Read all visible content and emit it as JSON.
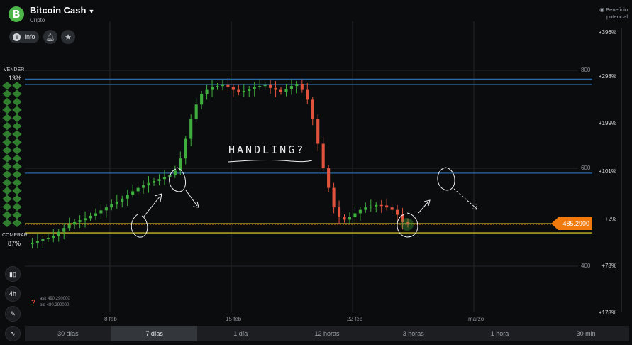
{
  "header": {
    "asset_name": "Bitcoin Cash",
    "asset_symbol_letter": "B",
    "asset_category": "Cripto",
    "info_label": "Info",
    "info_icon_char": "i",
    "alert_icon": "bell-icon",
    "favorite_icon": "star-icon"
  },
  "profit_label": {
    "line1": "Beneficio",
    "line2": "potencial"
  },
  "profit_scale": [
    "+396%",
    "+298%",
    "+199%",
    "+101%",
    "+2%",
    "+78%",
    "+178%"
  ],
  "price_axis": [
    "800",
    "600",
    "400"
  ],
  "sentiment": {
    "sell_label": "VENDER",
    "sell_pct": "13%",
    "buy_label": "COMPRAR",
    "buy_pct": "87%",
    "sell_fraction": 0.13,
    "buy_fraction": 0.87,
    "sell_color": "#8e2a2a",
    "buy_color": "#2f7f2f"
  },
  "side_tools": [
    {
      "name": "chart-type-button",
      "icon": "candles-icon"
    },
    {
      "name": "timeframe-button",
      "label": "4h"
    },
    {
      "name": "draw-tool-button",
      "icon": "pencil-icon"
    },
    {
      "name": "indicators-button",
      "icon": "indicator-icon"
    }
  ],
  "ask_bid": {
    "ask": "ask 490.290000",
    "bid": "bid 480.290000"
  },
  "current_price": "485.2900",
  "x_axis": [
    "8 feb",
    "15 feb",
    "22 feb",
    "marzo"
  ],
  "timeframes": [
    {
      "label": "30 días",
      "active": false
    },
    {
      "label": "7 días",
      "active": true
    },
    {
      "label": "1 día",
      "active": false
    },
    {
      "label": "12 horas",
      "active": false
    },
    {
      "label": "3 horas",
      "active": false
    },
    {
      "label": "1 hora",
      "active": false
    },
    {
      "label": "30 min",
      "active": false
    }
  ],
  "annotation_text": "HANDLING?",
  "colors": {
    "background": "#0b0c0e",
    "up_candle": "#3fae3f",
    "down_candle": "#e2533e",
    "blue_line": "#2b69a8",
    "yellow_line": "#c9b62a",
    "price_tag": "#f07a0e"
  },
  "chart_data": {
    "type": "candlestick",
    "title": "",
    "ylabel": "",
    "y_ticks": [
      400,
      600,
      800
    ],
    "ylim": [
      380,
      840
    ],
    "horizontal_levels": [
      {
        "value": 782,
        "color": "blue"
      },
      {
        "value": 771,
        "color": "blue"
      },
      {
        "value": 590,
        "color": "blue"
      },
      {
        "value": 487,
        "color": "yellow"
      },
      {
        "value": 468,
        "color": "yellow"
      }
    ],
    "current_price": 485.29,
    "close_series": [
      445,
      448,
      452,
      455,
      458,
      462,
      470,
      478,
      485,
      490,
      494,
      498,
      503,
      508,
      514,
      520,
      526,
      532,
      538,
      546,
      553,
      560,
      565,
      570,
      574,
      578,
      582,
      586,
      595,
      620,
      660,
      700,
      730,
      752,
      760,
      766,
      768,
      770,
      766,
      760,
      755,
      758,
      762,
      766,
      768,
      770,
      764,
      760,
      756,
      762,
      768,
      772,
      760,
      740,
      700,
      650,
      600,
      560,
      520,
      500,
      495,
      500,
      508,
      515,
      520,
      522,
      525,
      524,
      520,
      515,
      505,
      490,
      485
    ]
  }
}
